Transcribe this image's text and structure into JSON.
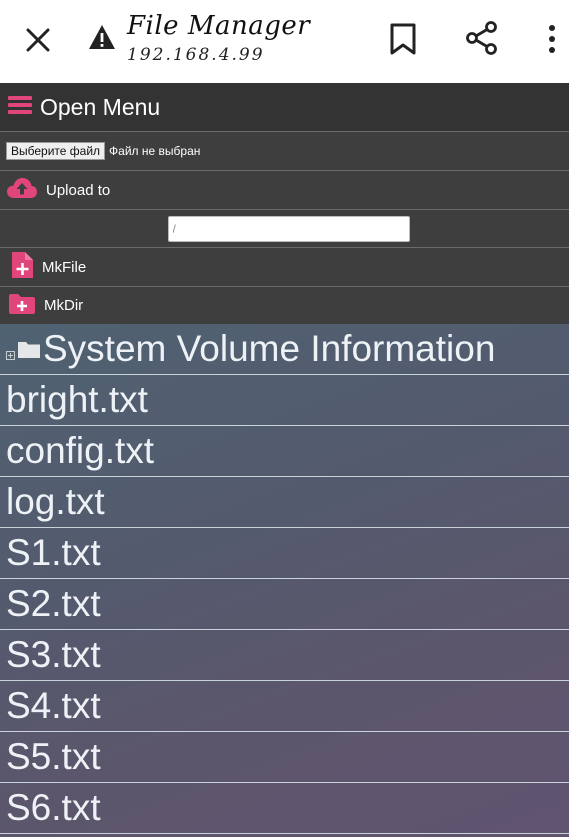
{
  "browser": {
    "title": "File Manager",
    "address": "192.168.4.99",
    "icons": [
      "close-icon",
      "warning-icon",
      "bookmark-icon",
      "share-icon",
      "more-vert-icon"
    ]
  },
  "menu": {
    "open_label": "Open Menu",
    "choose_file_label": "Выберите файл",
    "no_file_label": "Файл не выбран",
    "upload_label": "Upload to",
    "path_value": "/",
    "mkfile_label": "MkFile",
    "mkdir_label": "MkDir"
  },
  "files": [
    {
      "name": "System Volume Information",
      "type": "folder"
    },
    {
      "name": "bright.txt",
      "type": "file"
    },
    {
      "name": "config.txt",
      "type": "file"
    },
    {
      "name": "log.txt",
      "type": "file"
    },
    {
      "name": "S1.txt",
      "type": "file"
    },
    {
      "name": "S2.txt",
      "type": "file"
    },
    {
      "name": "S3.txt",
      "type": "file"
    },
    {
      "name": "S4.txt",
      "type": "file"
    },
    {
      "name": "S5.txt",
      "type": "file"
    },
    {
      "name": "S6.txt",
      "type": "file"
    }
  ],
  "colors": {
    "accent_pink": "#e0457b",
    "panel_bg": "#3e3e3e",
    "menu_header_bg": "#333333"
  }
}
